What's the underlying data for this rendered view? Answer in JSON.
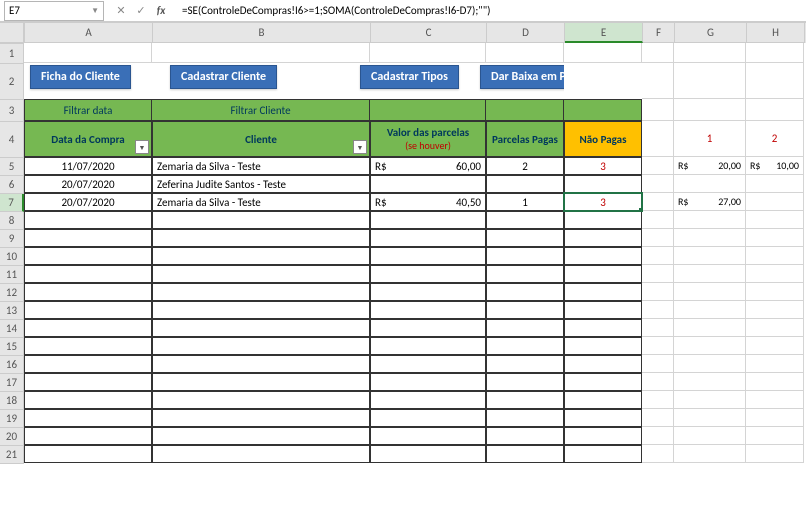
{
  "nameBox": "E7",
  "formula": "=SE(ControleDeCompras!I6>=1;SOMA(ControleDeCompras!I6-D7);\"\")",
  "columns": [
    "A",
    "B",
    "C",
    "D",
    "E",
    "F",
    "G",
    "H"
  ],
  "selectedCol": "E",
  "selectedRow": 7,
  "buttons": {
    "ficha": "Ficha do Cliente",
    "cadCliente": "Cadastrar Cliente",
    "cadTipos": "Cadastrar Tipos",
    "baixa": "Dar Baixa em Parcelas"
  },
  "filters": {
    "data": "Filtrar data",
    "cliente": "Filtrar Cliente"
  },
  "headers": {
    "data": "Data da Compra",
    "cliente": "Cliente",
    "valor": "Valor das parcelas",
    "valorSub": "(se houver)",
    "pagas": "Parcelas Pagas",
    "naoPagas": "Não Pagas",
    "g": "1",
    "h": "2"
  },
  "currency": "R$",
  "rows": [
    {
      "data": "11/07/2020",
      "cliente": "Zemaria da Silva - Teste",
      "valor": "60,00",
      "pagas": "2",
      "naoPagas": "3",
      "g": "20,00",
      "h": "10,00"
    },
    {
      "data": "20/07/2020",
      "cliente": "Zeferina Judite Santos - Teste",
      "valor": "",
      "pagas": "",
      "naoPagas": "",
      "g": "",
      "h": ""
    },
    {
      "data": "20/07/2020",
      "cliente": "Zemaria da Silva - Teste",
      "valor": "40,50",
      "pagas": "1",
      "naoPagas": "3",
      "g": "27,00",
      "h": ""
    }
  ],
  "rowNums": [
    1,
    2,
    3,
    4,
    5,
    6,
    7,
    8,
    9,
    10,
    11,
    12,
    13,
    14,
    15,
    16,
    17,
    18,
    19,
    20,
    21
  ]
}
